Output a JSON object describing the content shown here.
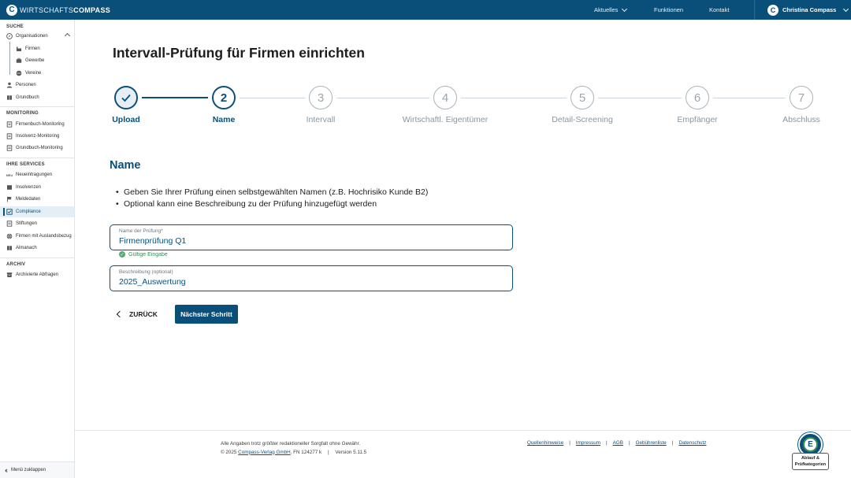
{
  "header": {
    "logo_light": "WIRTSCHAFTS",
    "logo_bold": "COMPASS",
    "nav": [
      "Aktuelles",
      "Funktionen",
      "Kontakt"
    ],
    "user_name": "Christina Compass"
  },
  "sidebar": {
    "sections": {
      "suche": "SUCHE",
      "monitoring": "MONITORING",
      "services": "IHRE SERVICES",
      "archiv": "ARCHIV"
    },
    "items": {
      "organisationen": "Organisationen",
      "firmen": "Firmen",
      "gewerbe": "Gewerbe",
      "vereine": "Vereine",
      "personen": "Personen",
      "grundbuch": "Grundbuch",
      "firmenbuch_monitoring": "Firmenbuch-Monitoring",
      "insolvenz_monitoring": "Insolvenz-Monitoring",
      "grundbuch_monitoring": "Grundbuch-Monitoring",
      "neueintragungen": "Neueintragungen",
      "insolvenzen": "Insolvenzen",
      "meldedaten": "Meldedaten",
      "compliance": "Compliance",
      "stiftungen": "Stiftungen",
      "auslandsbezug": "Firmen mit Auslandsbezug",
      "almanach": "Almanach",
      "archivierte": "Archivierte Abfragen"
    },
    "collapse_label": "Menü zuklappen"
  },
  "main": {
    "title": "Intervall-Prüfung für Firmen einrichten",
    "steps": [
      {
        "number": "1",
        "label": "Upload",
        "state": "done"
      },
      {
        "number": "2",
        "label": "Name",
        "state": "current"
      },
      {
        "number": "3",
        "label": "Intervall",
        "state": "todo"
      },
      {
        "number": "4",
        "label": "Wirtschaftl. Eigentümer",
        "state": "todo"
      },
      {
        "number": "5",
        "label": "Detail-Screening",
        "state": "todo"
      },
      {
        "number": "6",
        "label": "Empfänger",
        "state": "todo"
      },
      {
        "number": "7",
        "label": "Abschluss",
        "state": "todo"
      }
    ],
    "section_title": "Name",
    "bullets": [
      "Geben Sie Ihrer Prüfung einen selbstgewählten Namen (z.B. Hochrisiko Kunde B2)",
      "Optional kann eine Beschreibung zu der Prüfung hinzugefügt werden"
    ],
    "name_field": {
      "label": "Name der Prüfung*",
      "value": "Firmenprüfung Q1"
    },
    "valid_text": "Gültige Eingabe",
    "desc_field": {
      "label": "Beschreibung (optional)",
      "value": "2025_Auswertung"
    },
    "back_label": "ZURÜCK",
    "next_label": "Nächster Schritt"
  },
  "footer": {
    "disclaimer": "Alle Angaben trotz größter redaktioneller Sorgfalt ohne Gewähr.",
    "copyright": "© 2025",
    "publisher": "Compass-Verlag GmbH",
    "fn": ", FN 124277 k",
    "version": "Version 5.11.5",
    "links": [
      "Quellenhinweise",
      "Impressum",
      "AGB",
      "Gebührenliste",
      "Datenschutz"
    ],
    "help_line1": "Ablauf &",
    "help_line2": "Prüfkategorien"
  },
  "colors": {
    "brand": "#0a4f7a",
    "valid": "#3a8a5a"
  }
}
